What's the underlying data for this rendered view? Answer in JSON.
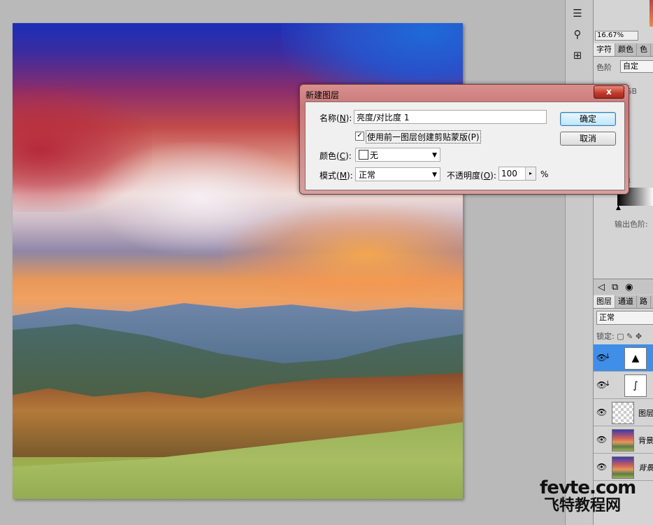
{
  "dock": {
    "zoom": "16.67%",
    "adjust_tabs": [
      "字符",
      "颜色",
      "色"
    ],
    "adjust_label": "色阶",
    "adjust_preset": "自定",
    "gb_fragment": "GB",
    "fragment_3": "3",
    "output_levels": "输出色阶:",
    "layers_tabs": [
      "图层",
      "通道",
      "路"
    ],
    "blend_mode": "正常",
    "lock_label": "锁定:",
    "layers": [
      {
        "name": "",
        "type": "brightness-contrast-adjustment",
        "selected": true,
        "clipped": true
      },
      {
        "name": "",
        "type": "curves-adjustment",
        "selected": false,
        "clipped": true
      },
      {
        "name": "图层",
        "type": "transparent-layer",
        "selected": false,
        "clipped": false
      },
      {
        "name": "背景",
        "type": "photo-layer",
        "selected": false,
        "clipped": false
      },
      {
        "name": "背景",
        "type": "photo-layer-italic",
        "selected": false,
        "clipped": false
      }
    ]
  },
  "dialog": {
    "title": "新建图层",
    "close_label": "x",
    "name_label": "名称(",
    "name_key": "N",
    "name_label_end": "):",
    "name_value": "亮度/对比度 1",
    "clip_checked": true,
    "clip_label": "使用前一图层创建剪贴蒙版(P)",
    "color_label": "颜色(",
    "color_key": "C",
    "color_label_end": "):",
    "color_value": "无",
    "mode_label": "模式(",
    "mode_key": "M",
    "mode_label_end": "):",
    "mode_value": "正常",
    "opacity_label": "不透明度(",
    "opacity_key": "O",
    "opacity_label_end": "):",
    "opacity_value": "100",
    "opacity_unit": "%",
    "ok_label": "确定",
    "cancel_label": "取消"
  },
  "watermark": {
    "en": "fevte.com",
    "cn": "飞特教程网"
  }
}
